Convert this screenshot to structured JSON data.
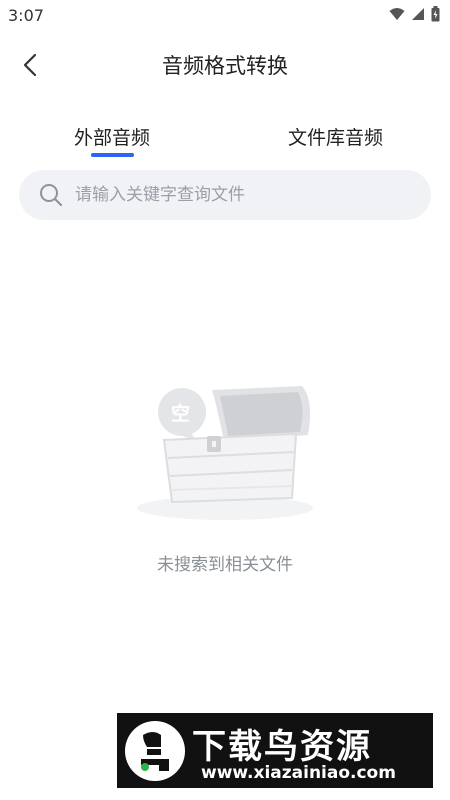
{
  "status_bar": {
    "time": "3:07",
    "icons": [
      "wifi-icon",
      "signal-icon",
      "battery-icon"
    ]
  },
  "header": {
    "back_icon": "chevron-left-icon",
    "title": "音频格式转换"
  },
  "tabs": [
    {
      "label": "外部音频",
      "active": true
    },
    {
      "label": "文件库音频",
      "active": false
    }
  ],
  "search": {
    "icon": "search-icon",
    "placeholder": "请输入关键字查询文件",
    "value": ""
  },
  "empty_state": {
    "badge": "空",
    "message": "未搜索到相关文件"
  },
  "watermark": {
    "title": "下载鸟资源",
    "url": "www.xiazainiao.com"
  },
  "colors": {
    "accent": "#2f63f6",
    "search_bg": "#f1f2f6",
    "placeholder": "#9aa0a8",
    "empty_text": "#8a8f97"
  }
}
